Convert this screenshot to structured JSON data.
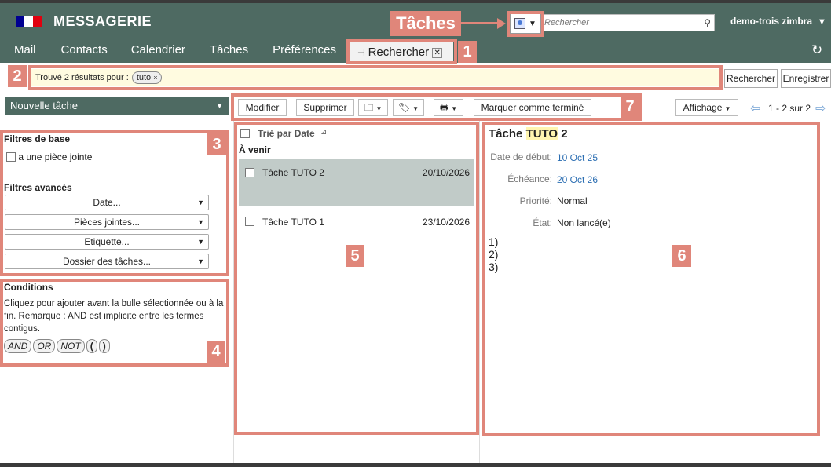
{
  "header": {
    "app_title": "MESSAGERIE",
    "search_placeholder": "Rechercher",
    "user": "demo-trois zimbra",
    "user_caret": "▾",
    "nav": [
      "Mail",
      "Contacts",
      "Calendrier",
      "Tâches",
      "Préférences"
    ],
    "active_tab": "Rechercher",
    "flag_colors": [
      "#000091",
      "#ffffff",
      "#e1000f"
    ]
  },
  "annotations": {
    "taches_label": "Tâches",
    "numbers": [
      "1",
      "2",
      "3",
      "4",
      "5",
      "6",
      "7"
    ],
    "color": "#e0867a"
  },
  "search_bar": {
    "result_text": "Trouvé 2 résultats pour :",
    "query_chip": "tuto",
    "chip_remove": "×",
    "search_button": "Rechercher",
    "save_button": "Enregistrer"
  },
  "left_panel": {
    "new_task": "Nouvelle tâche",
    "basic_filters_title": "Filtres de base",
    "attachment_filter": "a une pièce jointe",
    "advanced_filters_title": "Filtres avancés",
    "advanced_filters": [
      "Date...",
      "Pièces jointes...",
      "Etiquette...",
      "Dossier des tâches..."
    ],
    "conditions_title": "Conditions",
    "conditions_text": "Cliquez pour ajouter avant la bulle sélectionnée ou à la fin. Remarque : AND est implicite entre les termes contigus.",
    "operators": [
      "AND",
      "OR",
      "NOT",
      "(",
      ")"
    ]
  },
  "toolbar": {
    "edit": "Modifier",
    "delete": "Supprimer",
    "mark_done": "Marquer comme terminé",
    "view": "Affichage",
    "pagination": "1 - 2 sur 2"
  },
  "task_list": {
    "sort_label": "Trié par Date",
    "group": "À venir",
    "rows": [
      {
        "title": "Tâche TUTO 2",
        "date": "20/10/2026",
        "selected": true
      },
      {
        "title": "Tâche TUTO 1",
        "date": "23/10/2026",
        "selected": false
      }
    ]
  },
  "detail": {
    "title_prefix": "Tâche",
    "title_highlight": "TUTO",
    "title_suffix": "2",
    "fields": [
      {
        "label": "Date de début:",
        "value": "10 Oct 25",
        "link": true
      },
      {
        "label": "Échéance:",
        "value": "20 Oct 26",
        "link": true
      },
      {
        "label": "Priorité:",
        "value": "Normal",
        "link": false
      },
      {
        "label": "État:",
        "value": "Non lancé(e)",
        "link": false
      }
    ],
    "list_items": [
      "1)",
      "2)",
      "3)"
    ]
  }
}
